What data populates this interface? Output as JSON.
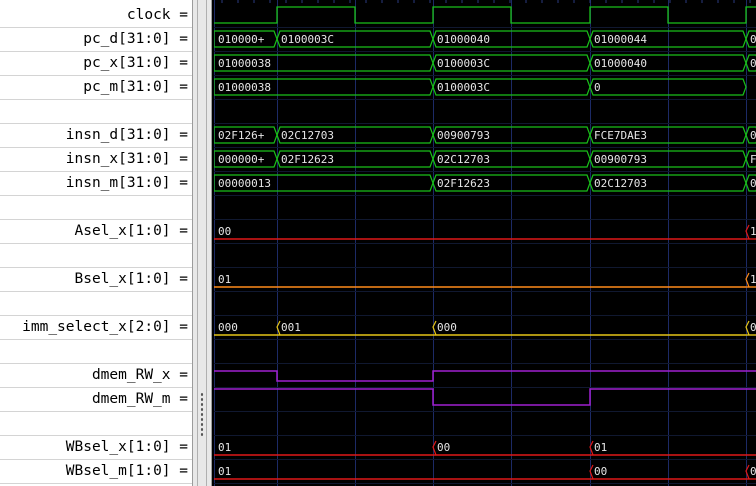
{
  "signals": [
    {
      "name": "clock",
      "kind": "clock",
      "color": "#19c019"
    },
    {
      "name": "pc_d[31:0]",
      "kind": "bus",
      "color": "#19c019",
      "segments": [
        {
          "label": "010000+"
        },
        {
          "label": "0100003C"
        },
        {
          "label": "01000040"
        },
        {
          "label": "01000044"
        },
        {
          "label": "0"
        }
      ]
    },
    {
      "name": "pc_x[31:0]",
      "kind": "bus",
      "color": "#19c019",
      "segments": [
        {
          "label": "01000038"
        },
        {
          "label": "0100003C"
        },
        {
          "label": "01000040"
        },
        {
          "label": "0"
        }
      ]
    },
    {
      "name": "pc_m[31:0]",
      "kind": "bus",
      "color": "#19c019",
      "segments": [
        {
          "label": "01000038"
        },
        {
          "label": "0100003C"
        },
        {
          "label": "0"
        }
      ]
    },
    {
      "name": "",
      "kind": "blank"
    },
    {
      "name": "insn_d[31:0]",
      "kind": "bus",
      "color": "#19c019",
      "segments": [
        {
          "label": "02F126+"
        },
        {
          "label": "02C12703"
        },
        {
          "label": "00900793"
        },
        {
          "label": "FCE7DAE3"
        },
        {
          "label": "0"
        }
      ]
    },
    {
      "name": "insn_x[31:0]",
      "kind": "bus",
      "color": "#19c019",
      "segments": [
        {
          "label": "000000+"
        },
        {
          "label": "02F12623"
        },
        {
          "label": "02C12703"
        },
        {
          "label": "00900793"
        },
        {
          "label": "F"
        }
      ]
    },
    {
      "name": "insn_m[31:0]",
      "kind": "bus",
      "color": "#19c019",
      "segments": [
        {
          "label": "00000013"
        },
        {
          "label": "02F12623"
        },
        {
          "label": "02C12703"
        },
        {
          "label": "0"
        }
      ]
    },
    {
      "name": "",
      "kind": "blank"
    },
    {
      "name": "Asel_x[1:0]",
      "kind": "flat",
      "color": "#e01818",
      "segments": [
        {
          "label": "00"
        },
        {
          "label": "1"
        }
      ]
    },
    {
      "name": "",
      "kind": "blank"
    },
    {
      "name": "Bsel_x[1:0]",
      "kind": "flat",
      "color": "#ff8c1a",
      "segments": [
        {
          "label": "01"
        },
        {
          "label": "1"
        }
      ]
    },
    {
      "name": "",
      "kind": "blank"
    },
    {
      "name": "imm_select_x[2:0]",
      "kind": "flat",
      "color": "#e6c619",
      "segments": [
        {
          "label": "000"
        },
        {
          "label": "001"
        },
        {
          "label": "000"
        },
        {
          "label": "0"
        }
      ]
    },
    {
      "name": "",
      "kind": "blank"
    },
    {
      "name": "dmem_RW_x",
      "kind": "bit",
      "color": "#a020d0"
    },
    {
      "name": "dmem_RW_m",
      "kind": "bit",
      "color": "#a020d0"
    },
    {
      "name": "",
      "kind": "blank"
    },
    {
      "name": "WBsel_x[1:0]",
      "kind": "flat",
      "color": "#e01818",
      "segments": [
        {
          "label": "01"
        },
        {
          "label": "00"
        },
        {
          "label": "01"
        }
      ]
    },
    {
      "name": "WBsel_m[1:0]",
      "kind": "flat",
      "color": "#e01818",
      "segments": [
        {
          "label": "01"
        },
        {
          "label": "00"
        },
        {
          "label": "0"
        }
      ]
    }
  ],
  "colors": {
    "background": "#000000",
    "gridline": "#1c2a66",
    "name_panel": "#ffffff",
    "value_text": "#e6e6e6"
  }
}
